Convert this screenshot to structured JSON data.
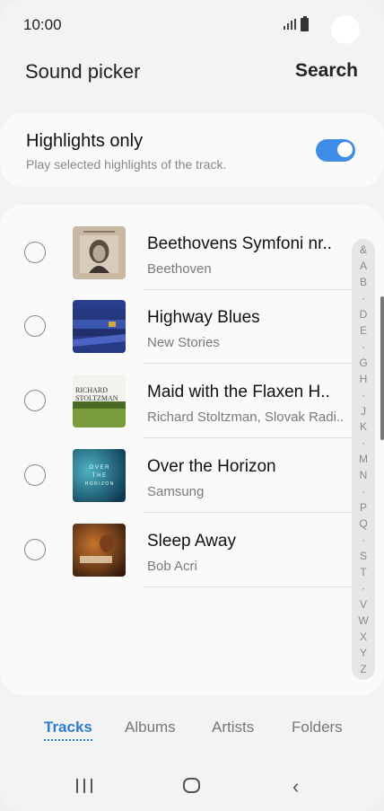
{
  "status": {
    "time": "10:00"
  },
  "header": {
    "title": "Sound picker",
    "search": "Search"
  },
  "highlights": {
    "title": "Highlights only",
    "subtitle": "Play selected highlights of the track.",
    "enabled": true
  },
  "tracks": [
    {
      "title": "Beethovens Symfoni nr..",
      "artist": "Beethoven"
    },
    {
      "title": "Highway Blues",
      "artist": "New Stories"
    },
    {
      "title": "Maid with the Flaxen H..",
      "artist": "Richard Stoltzman, Slovak Radi.."
    },
    {
      "title": "Over the Horizon",
      "artist": "Samsung"
    },
    {
      "title": "Sleep Away",
      "artist": "Bob Acri"
    }
  ],
  "index": [
    "&",
    "A",
    "B",
    "·",
    "D",
    "E",
    "·",
    "G",
    "H",
    "·",
    "J",
    "K",
    "·",
    "M",
    "N",
    "·",
    "P",
    "Q",
    "·",
    "S",
    "T",
    "·",
    "V",
    "W",
    "X",
    "Y",
    "Z"
  ],
  "tabs": {
    "tracks": "Tracks",
    "albums": "Albums",
    "artists": "Artists",
    "folders": "Folders"
  },
  "art_text": {
    "maid_line1": "RICHARD",
    "maid_line2": "STOLTZMAN",
    "horizon_line1": "O V E R",
    "horizon_line2": "T H E",
    "horizon_line3": "H O R I Z O N"
  }
}
